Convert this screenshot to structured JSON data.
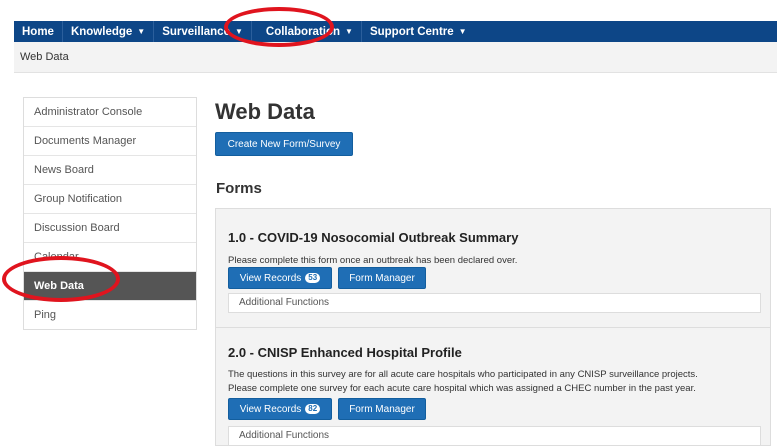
{
  "nav": {
    "items": [
      {
        "label": "Home",
        "has_dropdown": false
      },
      {
        "label": "Knowledge",
        "has_dropdown": true
      },
      {
        "label": "Surveillance",
        "has_dropdown": true
      },
      {
        "label": "Collaboration",
        "has_dropdown": true
      },
      {
        "label": "Support Centre",
        "has_dropdown": true
      }
    ]
  },
  "breadcrumb": "Web Data",
  "sidebar": {
    "items": [
      {
        "label": "Administrator Console"
      },
      {
        "label": "Documents Manager"
      },
      {
        "label": "News Board"
      },
      {
        "label": "Group Notification"
      },
      {
        "label": "Discussion Board"
      },
      {
        "label": "Calendar"
      },
      {
        "label": "Web Data",
        "active": true
      },
      {
        "label": "Ping"
      }
    ]
  },
  "main": {
    "title": "Web Data",
    "create_button": "Create New Form/Survey",
    "forms_heading": "Forms",
    "forms": [
      {
        "title": "1.0 - COVID-19 Nosocomial Outbreak Summary",
        "description": [
          "Please complete this form once an outbreak has been declared over."
        ],
        "view_label": "View Records",
        "record_count": "53",
        "manager_label": "Form Manager",
        "additional_label": "Additional Functions"
      },
      {
        "title": "2.0 - CNISP Enhanced Hospital Profile",
        "description": [
          "The questions in this survey are for all acute care hospitals who participated in any CNISP surveillance projects.",
          "Please complete one survey for each acute care hospital which was assigned a CHEC number in the past year."
        ],
        "view_label": "View Records",
        "record_count": "82",
        "manager_label": "Form Manager",
        "additional_label": "Additional Functions"
      }
    ]
  },
  "colors": {
    "navbar": "#0d4687",
    "button": "#1f6eb5",
    "sidebar_active": "#555555",
    "annotation": "#e0141e"
  }
}
